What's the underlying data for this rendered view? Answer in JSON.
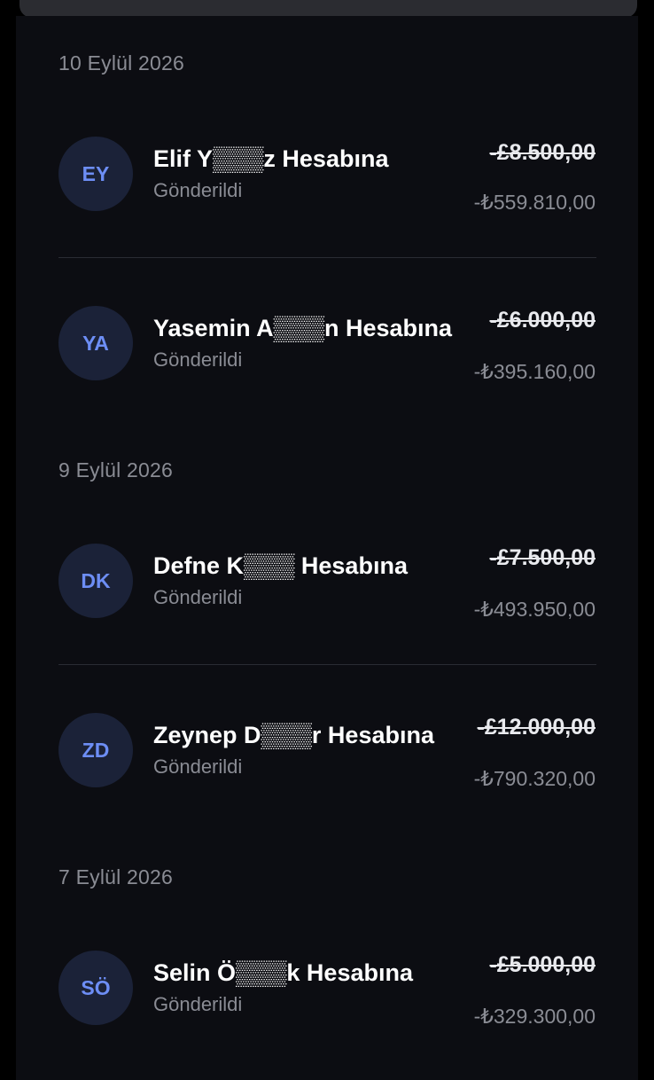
{
  "groups": [
    {
      "date": "10 Eylül 2026",
      "items": [
        {
          "initials": "EY",
          "name": "Elif Y▒▒▒z Hesabına",
          "status": "Gönderildi",
          "amount_gbp": "-£8.500,00",
          "amount_try": "-₺559.810,00"
        },
        {
          "initials": "YA",
          "name": "Yasemin A▒▒▒n Hesabına",
          "status": "Gönderildi",
          "amount_gbp": "-£6.000,00",
          "amount_try": "-₺395.160,00"
        }
      ]
    },
    {
      "date": "9 Eylül 2026",
      "items": [
        {
          "initials": "DK",
          "name": "Defne K▒▒▒ Hesabına",
          "status": "Gönderildi",
          "amount_gbp": "-£7.500,00",
          "amount_try": "-₺493.950,00"
        },
        {
          "initials": "ZD",
          "name": "Zeynep D▒▒▒r Hesabına",
          "status": "Gönderildi",
          "amount_gbp": "-£12.000,00",
          "amount_try": "-₺790.320,00"
        }
      ]
    },
    {
      "date": "7 Eylül 2026",
      "items": [
        {
          "initials": "SÖ",
          "name": "Selin Ö▒▒▒k Hesabına",
          "status": "Gönderildi",
          "amount_gbp": "-£5.000,00",
          "amount_try": "-₺329.300,00"
        }
      ]
    }
  ],
  "colors": {
    "background": "#0c0d12",
    "avatar_bg": "#1b2238",
    "avatar_text": "#6d8ef5",
    "muted_text": "#8a8c94"
  }
}
